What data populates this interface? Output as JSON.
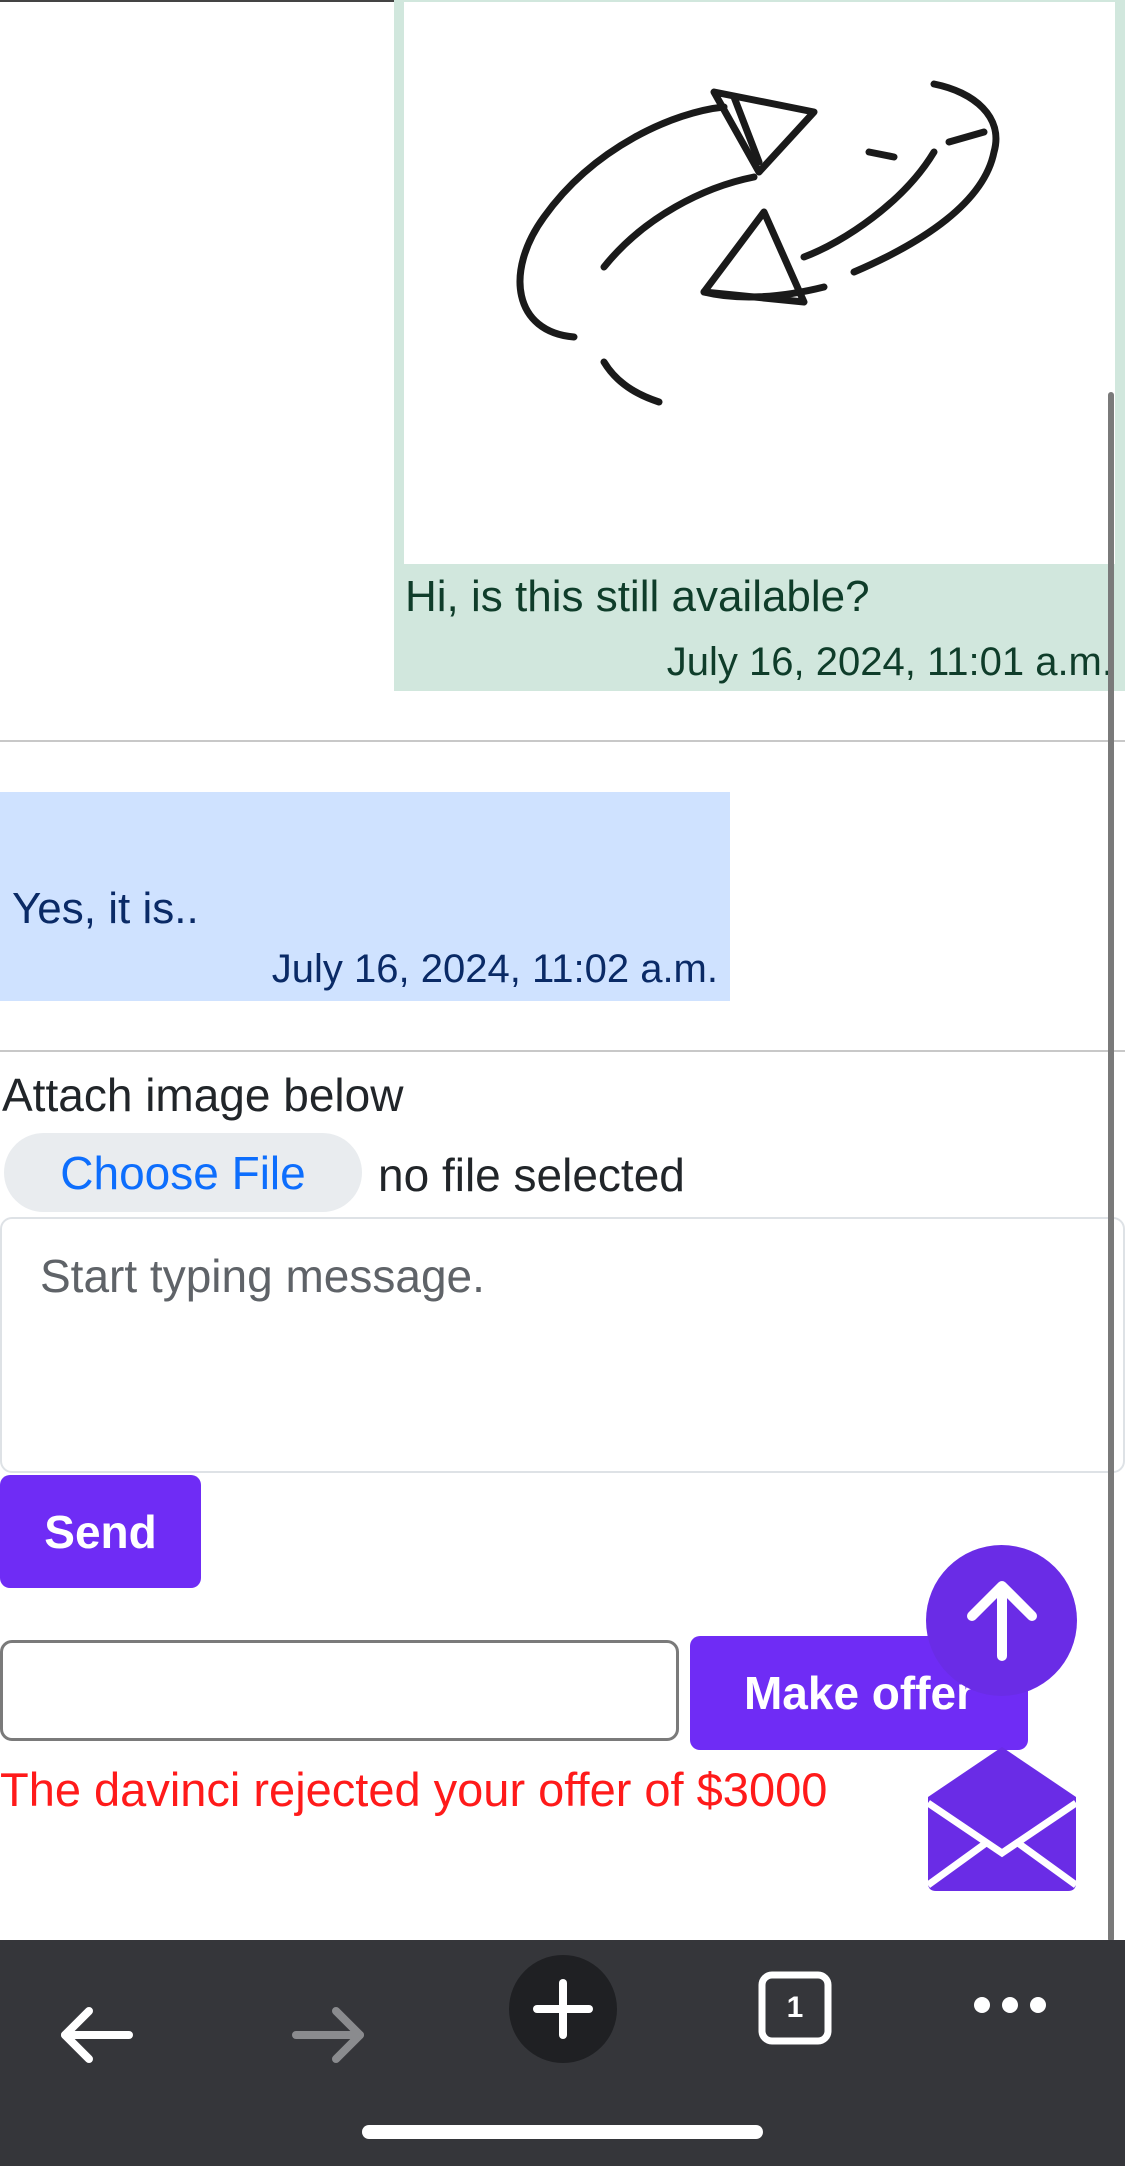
{
  "conversation": {
    "sent_message": {
      "image_icon": "refresh-arrows-icon",
      "text": "Hi, is this still available?",
      "timestamp": "July 16, 2024, 11:01 a.m."
    },
    "received_message": {
      "text": "Yes, it is..",
      "timestamp": "July 16, 2024, 11:02 a.m."
    }
  },
  "compose": {
    "attach_label": "Attach image below",
    "choose_file_label": "Choose File",
    "file_status": "no file selected",
    "message_placeholder": "Start typing message.",
    "send_label": "Send"
  },
  "offer": {
    "amount_value": "",
    "make_offer_label": "Make offer",
    "status_text": "The davinci rejected your offer of $3000"
  },
  "floating": {
    "scroll_top_icon": "arrow-up-icon",
    "mail_icon": "envelope-open-icon"
  },
  "browser_toolbar": {
    "tab_count": "1",
    "icons": [
      "back-arrow-icon",
      "forward-arrow-icon",
      "new-tab-plus-icon",
      "tab-switcher-icon",
      "more-menu-icon"
    ]
  },
  "colors": {
    "sent_bubble": "#d1e7dd",
    "received_bubble": "#cfe2ff",
    "accent_purple": "#6f2cf5",
    "error_red": "#ff1a1a",
    "toolbar_bg": "#35363a"
  }
}
